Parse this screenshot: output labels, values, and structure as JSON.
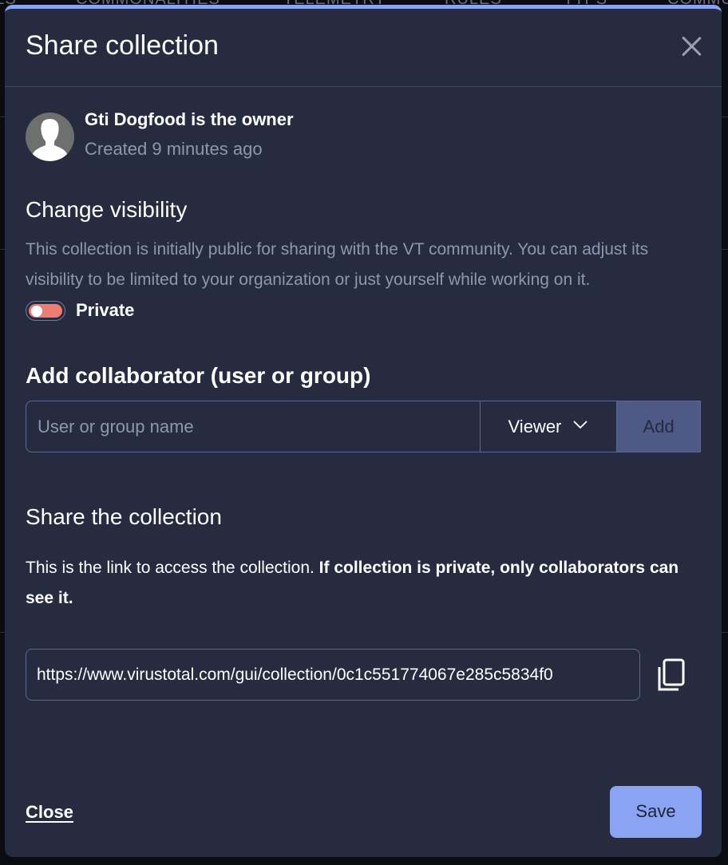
{
  "background": {
    "tabs": [
      "ES",
      "COMMONALITIES",
      "TELEMETRY",
      "RULES",
      "TTPS",
      "COMMU"
    ]
  },
  "modal": {
    "title": "Share collection",
    "close_icon": "close-icon",
    "owner": {
      "name_line": "Gti Dogfood is the owner",
      "created": "Created 9 minutes ago",
      "avatar_icon": "person-silhouette-icon"
    },
    "visibility": {
      "title": "Change visibility",
      "description": "This collection is initially public for sharing with the VT community. You can adjust its visibility to be limited to your organization or just yourself while working on it.",
      "toggle_label": "Private",
      "toggle_on": false,
      "toggle_color": "#ef7b73"
    },
    "collaborator": {
      "title": "Add collaborator (user or group)",
      "input_value": "",
      "input_placeholder": "User or group name",
      "role_selected": "Viewer",
      "add_label": "Add"
    },
    "share": {
      "title": "Share the collection",
      "description_plain": "This is the link to access the collection. ",
      "description_bold": "If collection is private, only collaborators can see it.",
      "link_value": "https://www.virustotal.com/gui/collection/0c1c551774067e285c5834f0",
      "copy_icon": "copy-icon"
    },
    "footer": {
      "close_label": "Close",
      "save_label": "Save"
    },
    "colors": {
      "accent": "#8aa4f3",
      "modal_bg": "#262b3f",
      "page_bg": "#0b0c12",
      "muted_text": "#8e97b0"
    }
  }
}
